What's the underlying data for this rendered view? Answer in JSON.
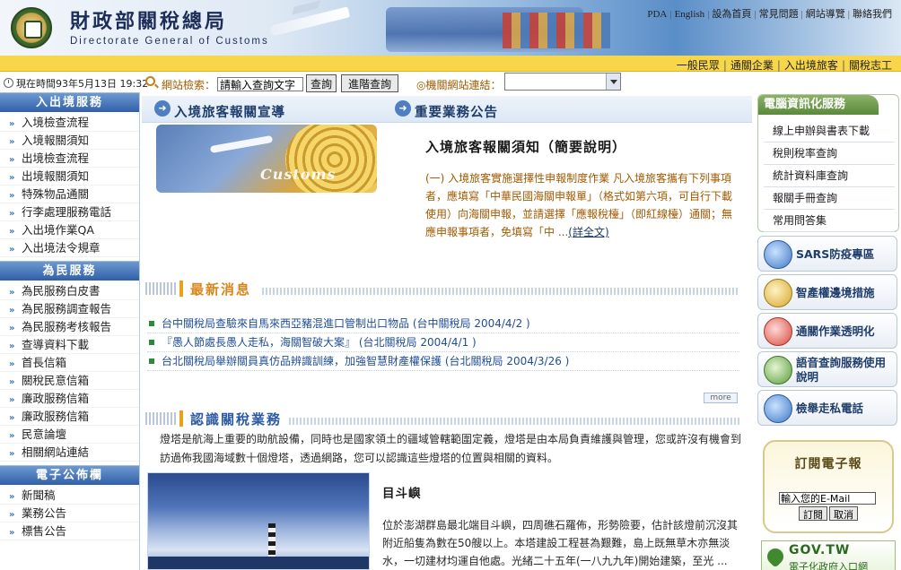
{
  "header": {
    "title": "財政部關稅總局",
    "title_en": "Directorate General of Customs",
    "links": [
      "PDA",
      "English",
      "設為首頁",
      "常見問題",
      "網站導覽",
      "聯絡我們"
    ]
  },
  "catbar": {
    "links": [
      "一般民眾",
      "通關企業",
      "入出境旅客",
      "關稅志工"
    ]
  },
  "timebar": {
    "text": "現在時間93年5月13日 19:32"
  },
  "search": {
    "label": "網站檢索：",
    "value": "請輸入查詢文字",
    "button": "查詢",
    "advanced_button": "進階查詢",
    "org_label": "◎機關網站連結：",
    "org_selected": ""
  },
  "sidebar": {
    "sections": [
      {
        "title": "入出境服務",
        "items": [
          "入境檢查流程",
          "入境報關須知",
          "出境檢查流程",
          "出境報關須知",
          "特殊物品通關",
          "行李處理服務電話",
          "入出境作業QA",
          "入出境法令規章"
        ]
      },
      {
        "title": "為民服務",
        "items": [
          "為民服務白皮書",
          "為民服務調查報告",
          "為民服務考核報告",
          "查導資料下載",
          "首長信箱",
          "關稅民意信箱",
          "廉政服務信箱",
          "廉政服務信箱",
          "民意論壇",
          "相關網站連結"
        ]
      },
      {
        "title": "電子公佈欄",
        "items": [
          "新聞稿",
          "業務公告",
          "標售公告"
        ]
      }
    ]
  },
  "main": {
    "tab1": "入境旅客報關宣導",
    "tab2": "重要業務公告",
    "promo_word": "Customs",
    "notice_title": "入境旅客報關須知（簡要說明）",
    "notice_body": "(一) 入境旅客實施選擇性申報制度作業 凡入境旅客攜有下列事項者，應填寫「中華民國海關申報單」（格式如第六項，可自行下載使用）向海關申報，並請選擇「應報稅檯」（即紅線檯）通關；無應申報事項者，免填寫「中 ...",
    "notice_more": "(詳全文)",
    "news_title": "最新消息",
    "news": [
      {
        "text": "台中關稅局查驗來自馬來西亞豬混進口管制出口物品",
        "src": "(台中關稅局 2004/4/2 )"
      },
      {
        "text": "『愚人節處長愚人走私，海關智破大案』",
        "src": "(台北關稅局 2004/4/1 )"
      },
      {
        "text": "台北關稅局舉辦關員真仿品辨識訓練，加強智慧財產權保護",
        "src": "(台北關稅局 2004/3/26 )"
      }
    ],
    "more": "more",
    "about_title": "認識關稅業務",
    "about_text": "燈塔是航海上重要的助航設備，同時也是國家領土的疆域管轄範圍定義，燈塔是由本局負責維護與管理，您或許沒有機會到訪過佈我國海域數十個燈塔，透過網路，您可以認識這些燈塔的位置與相關的資料。",
    "lh_title": "目斗嶼",
    "lh_body": "位於澎湖群島最北端目斗嶼，四周礁石羅佈，形勢險要，估計該燈前沉沒其附近船隻為數在50艘以上。本塔建設工程甚為艱難，島上既無草木亦無淡水，一切建材均運自他處。光緒二十五年(一八九九年)開始建築，至光 ..."
  },
  "right": {
    "svc_title": "電腦資訊化服務",
    "svc_items": [
      "線上申辦與書表下載",
      "稅則稅率查詢",
      "統計資料庫查詢",
      "報關手冊查詢",
      "常用問答集"
    ],
    "cards": [
      "SARS防疫專區",
      "智產權邊境措施",
      "通關作業透明化",
      "語音查詢服務使用說明",
      "檢舉走私電話"
    ],
    "epaper_title": "訂閱電子報",
    "epaper_placeholder": "輸入您的E-Mail",
    "epaper_submit": "訂閱",
    "epaper_cancel": "取消",
    "gov_text": "GOV.TW",
    "gov_sub": "電子化政府入口網"
  }
}
